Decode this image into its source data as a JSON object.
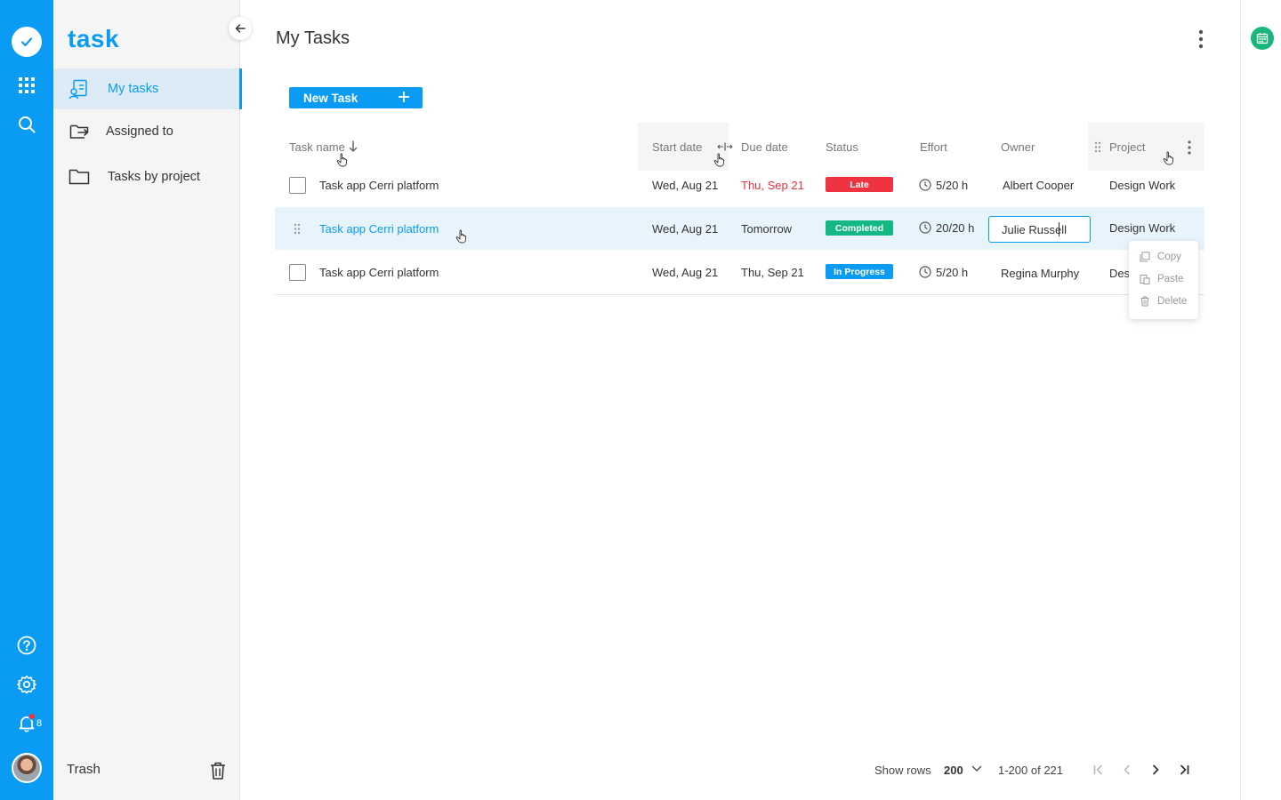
{
  "app": {
    "logo": "task"
  },
  "rail": {
    "notification_count": "8",
    "colors": {
      "rail": "#0a9cf5",
      "badge": "#ff2d3a"
    }
  },
  "sidebar": {
    "items": [
      {
        "label": "My tasks",
        "icon": "task-list-icon",
        "active": true
      },
      {
        "label": "Assigned to",
        "icon": "assigned-icon",
        "active": false
      },
      {
        "label": "Tasks by project",
        "icon": "folder-icon",
        "active": false
      }
    ],
    "trash_label": "Trash"
  },
  "main": {
    "title": "My Tasks",
    "new_task_label": "New Task",
    "columns": {
      "task_name": "Task name",
      "start_date": "Start date",
      "due_date": "Due date",
      "status": "Status",
      "effort": "Effort",
      "owner": "Owner",
      "project": "Project"
    },
    "rows": [
      {
        "task": "Task app Cerri platform",
        "start": "Wed, Aug 21",
        "due": "Thu, Sep 21",
        "status": "Late",
        "effort": "5/20 h",
        "owner": "Albert Cooper",
        "project": "Design Work"
      },
      {
        "task": "Task app Cerri platform",
        "start": "Wed, Aug 21",
        "due": "Tomorrow",
        "status": "Completed",
        "effort": "20/20 h",
        "owner": "Julie Russell",
        "project": "Design Work"
      },
      {
        "task": "Task app Cerri platform",
        "start": "Wed, Aug 21",
        "due": "Thu, Sep 21",
        "status": "In Progress",
        "effort": "5/20 h",
        "owner": "Regina Murphy",
        "project": "Des"
      }
    ],
    "context_menu": [
      {
        "label": "Copy",
        "icon": "copy-icon"
      },
      {
        "label": "Paste",
        "icon": "paste-icon"
      },
      {
        "label": "Delete",
        "icon": "delete-icon"
      }
    ],
    "status_colors": {
      "Late": "#ef3340",
      "Completed": "#14b884",
      "In Progress": "#0a9cf5"
    },
    "late_date_color": "#e8323c"
  },
  "pagination": {
    "show_rows_label": "Show rows",
    "rows_per_page": "200",
    "range": "1-200 of 221"
  }
}
